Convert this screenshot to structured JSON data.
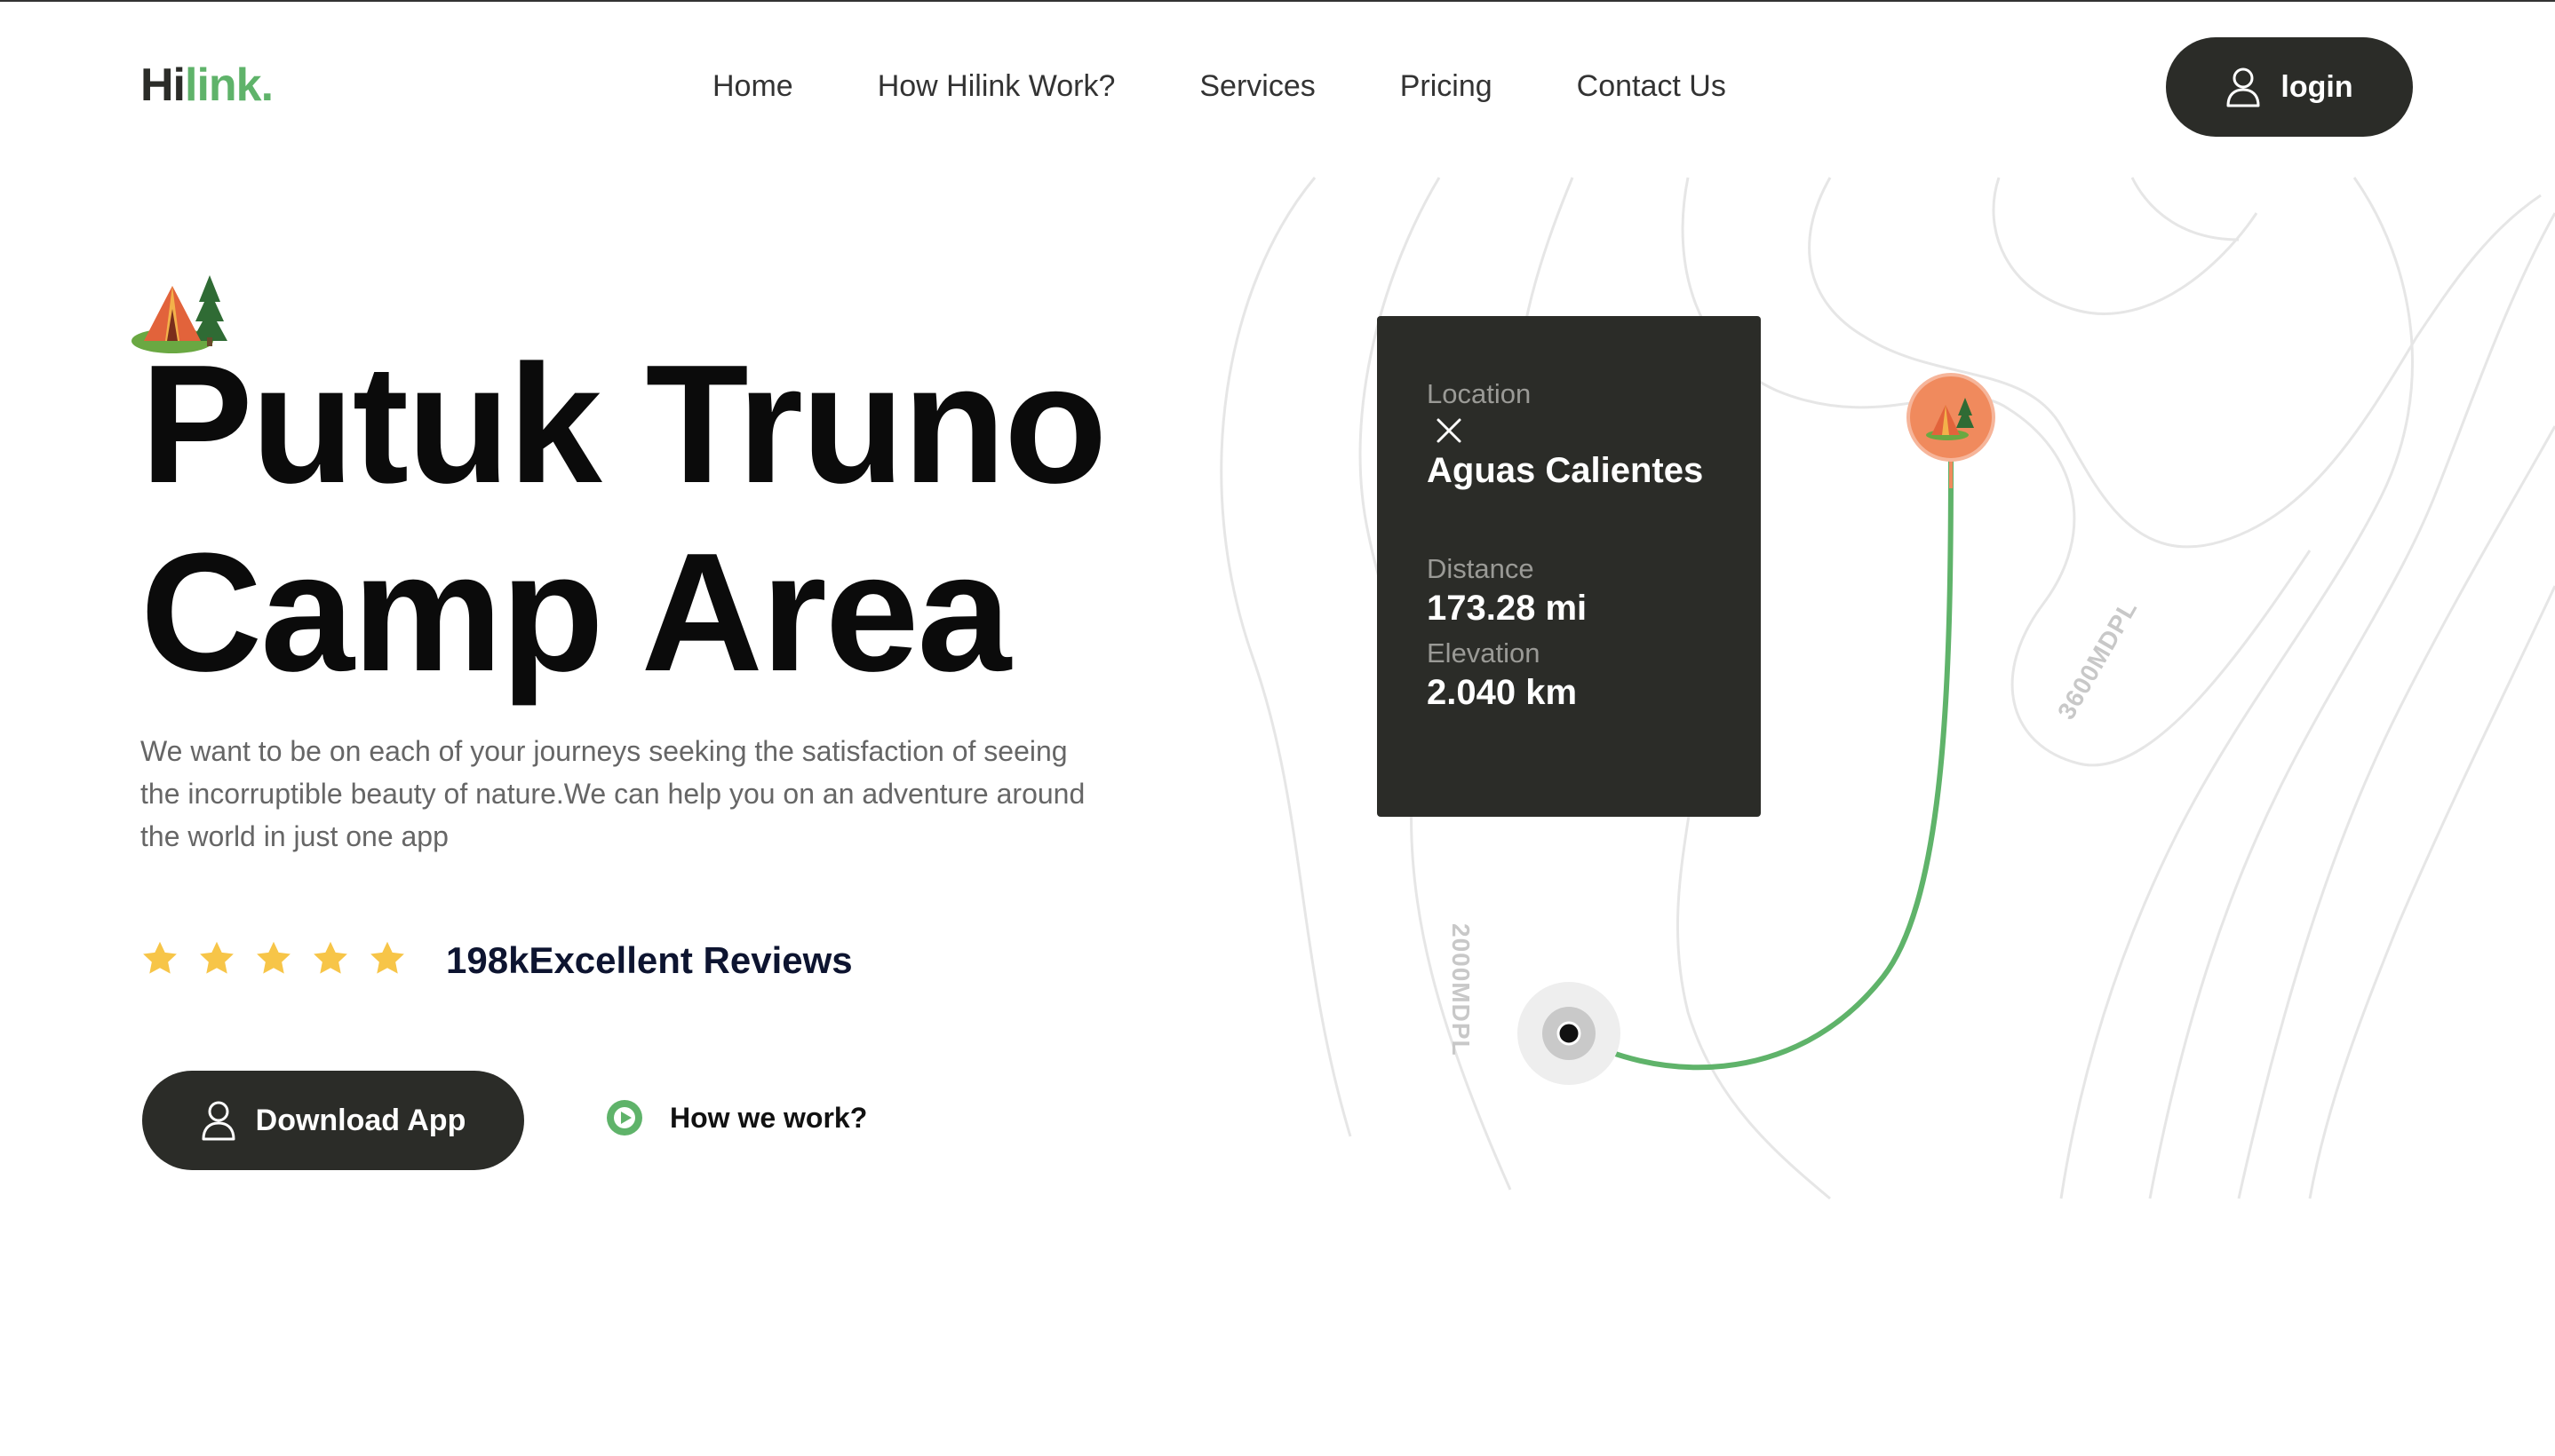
{
  "header": {
    "logo": {
      "part1": "Hi",
      "part2": "link."
    },
    "nav": [
      "Home",
      "How Hilink Work?",
      "Services",
      "Pricing",
      "Contact Us"
    ],
    "login_label": "login"
  },
  "hero": {
    "title_line1": "Putuk Truno",
    "title_line2": "Camp Area",
    "description": "We want to be on each of your journeys seeking the satisfaction of seeing the incorruptible beauty of nature.We can help you on an adventure around the world in just one app",
    "rating_stars": 5,
    "reviews_text": "198kExcellent Reviews",
    "download_label": "Download App",
    "how_label": "How we work?"
  },
  "card": {
    "location_label": "Location",
    "location_value": "Aguas Calientes",
    "distance_label": "Distance",
    "distance_value": "173.28 mi",
    "elevation_label": "Elevation",
    "elevation_value": "2.040 km"
  },
  "map": {
    "contour_label_1": "3600MDPL",
    "contour_label_2": "2000MDPL"
  },
  "colors": {
    "dark": "#2b2c28",
    "green": "#5fb36a",
    "star": "#f7c548",
    "pin": "#f08a5d"
  },
  "icons": [
    "user-icon",
    "play-icon",
    "star-icon",
    "close-icon",
    "tent-icon",
    "map-pin-icon"
  ]
}
